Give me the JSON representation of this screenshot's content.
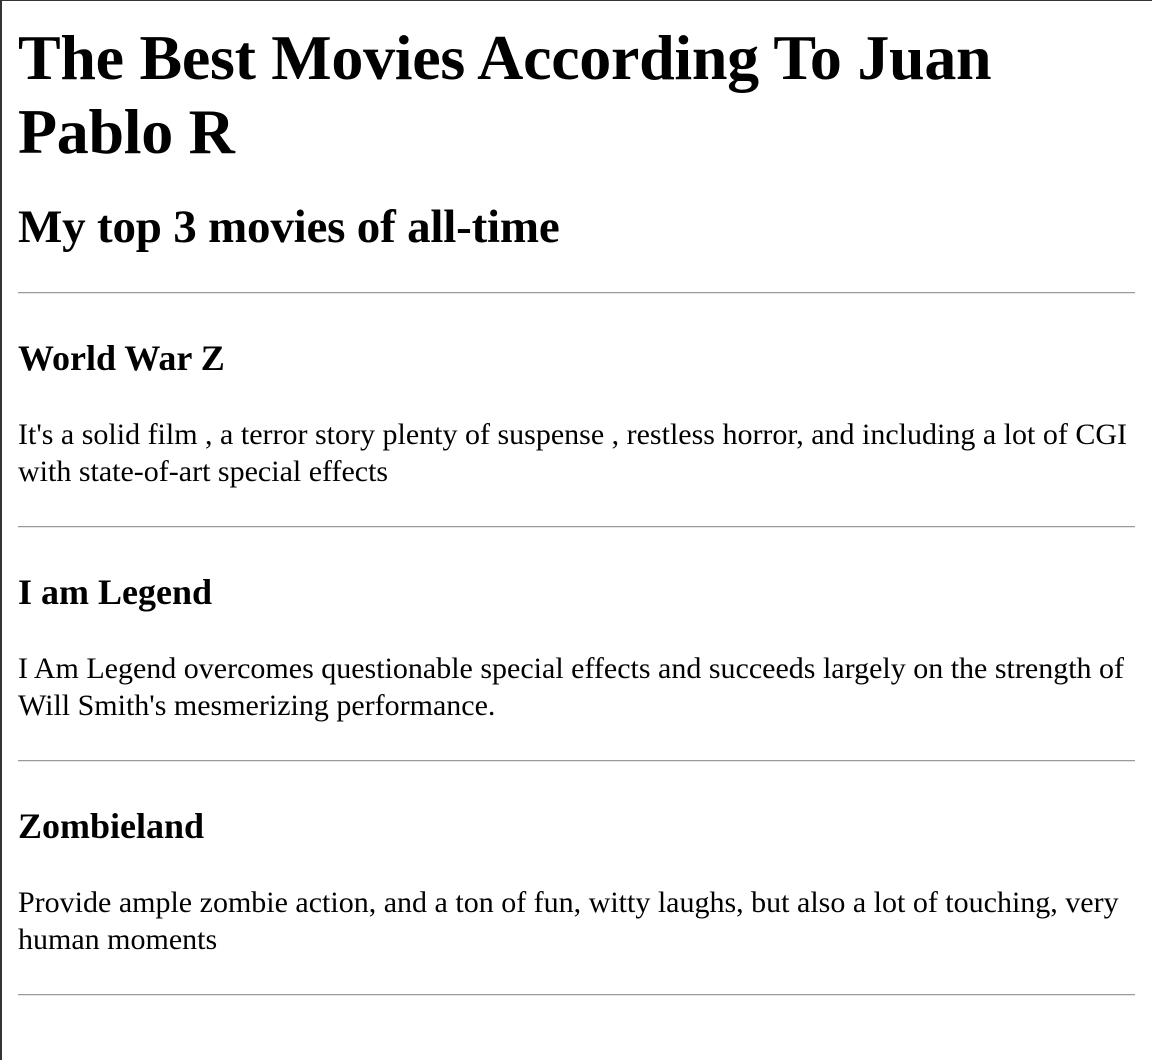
{
  "page": {
    "title": "The Best Movies According To Juan Pablo R",
    "subtitle": "My top 3 movies of all-time"
  },
  "movies": [
    {
      "title": "World War Z",
      "description": "It's a solid film , a terror story plenty of suspense , restless horror, and including a lot of CGI with state-of-art special effects"
    },
    {
      "title": "I am Legend",
      "description": "I Am Legend overcomes questionable special effects and succeeds largely on the strength of Will Smith's mesmerizing performance."
    },
    {
      "title": "Zombieland",
      "description": "Provide ample zombie action, and a ton of fun, witty laughs, but also a lot of touching, very human moments"
    }
  ]
}
